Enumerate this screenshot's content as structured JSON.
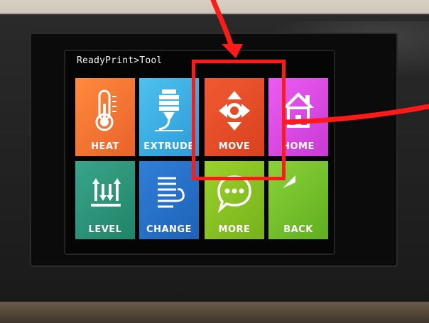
{
  "screen": {
    "breadcrumb": "ReadyPrint>Tool"
  },
  "tiles": [
    {
      "label": "HEAT",
      "icon": "thermometer-icon",
      "color": "#f07a35"
    },
    {
      "label": "EXTRUDE",
      "icon": "extruder-nozzle-icon",
      "color": "#3aaee4"
    },
    {
      "label": "MOVE",
      "icon": "move-arrows-icon",
      "color": "#e54b27"
    },
    {
      "label": "HOME",
      "icon": "house-icon",
      "color": "#dc4ce6"
    },
    {
      "label": "LEVEL",
      "icon": "level-arrows-icon",
      "color": "#2d9a7c"
    },
    {
      "label": "CHANGE",
      "icon": "filament-spool-icon",
      "color": "#2870c8"
    },
    {
      "label": "MORE",
      "icon": "chat-bubble-icon",
      "color": "#8cc423"
    },
    {
      "label": "BACK",
      "icon": "back-arrow-icon",
      "color": "#72c02b"
    }
  ],
  "annotation": {
    "color": "#ff1a1a",
    "target": "MOVE"
  }
}
